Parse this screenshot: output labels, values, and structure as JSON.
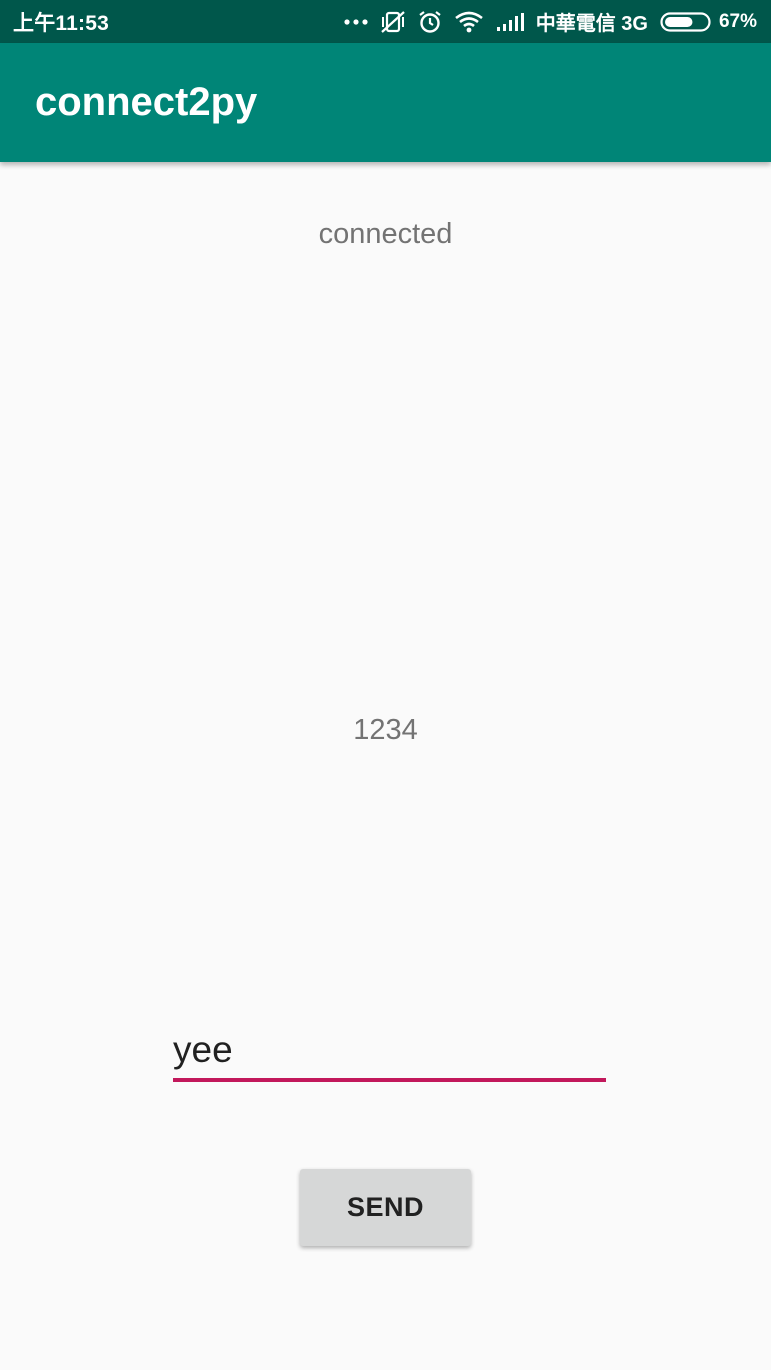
{
  "status_bar": {
    "time": "上午11:53",
    "carrier": "中華電信 3G",
    "battery_percent": "67%",
    "battery_level": 0.67,
    "icons": [
      "more-dots-icon",
      "vibrate-off-icon",
      "alarm-icon",
      "wifi-icon",
      "signal-icon",
      "battery-icon"
    ]
  },
  "app_bar": {
    "title": "connect2py"
  },
  "main": {
    "status_text": "connected",
    "value_text": "1234",
    "input_value": "yee",
    "send_label": "SEND"
  },
  "colors": {
    "status_bar": "#00574b",
    "app_bar": "#008577",
    "accent": "#c2185b",
    "background": "#fafafa",
    "button": "#d6d7d7"
  }
}
